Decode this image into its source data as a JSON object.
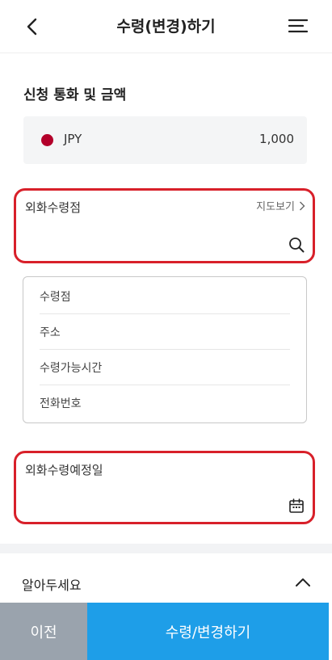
{
  "header": {
    "title": "수령(변경)하기",
    "back_icon": "chevron-left-icon",
    "menu_icon": "hamburger-menu-icon"
  },
  "request": {
    "section_title": "신청 통화 및 금액",
    "currency_code": "JPY",
    "amount": "1,000",
    "flag_color": "#b3002a"
  },
  "branch_field": {
    "label": "외화수령점",
    "map_link": "지도보기",
    "value": "",
    "icon": "search-icon"
  },
  "branch_info": {
    "rows": [
      "수령점",
      "주소",
      "수령가능시간",
      "전화번호"
    ]
  },
  "date_field": {
    "label": "외화수령예정일",
    "value": "",
    "icon": "calendar-icon"
  },
  "notice": {
    "title": "알아두세요",
    "icon": "chevron-up-icon"
  },
  "footer": {
    "prev_label": "이전",
    "submit_label": "수령/변경하기",
    "prev_color": "#9aa3ad",
    "submit_color": "#1e9ee8"
  },
  "colors": {
    "highlight_border": "#d8202a"
  }
}
